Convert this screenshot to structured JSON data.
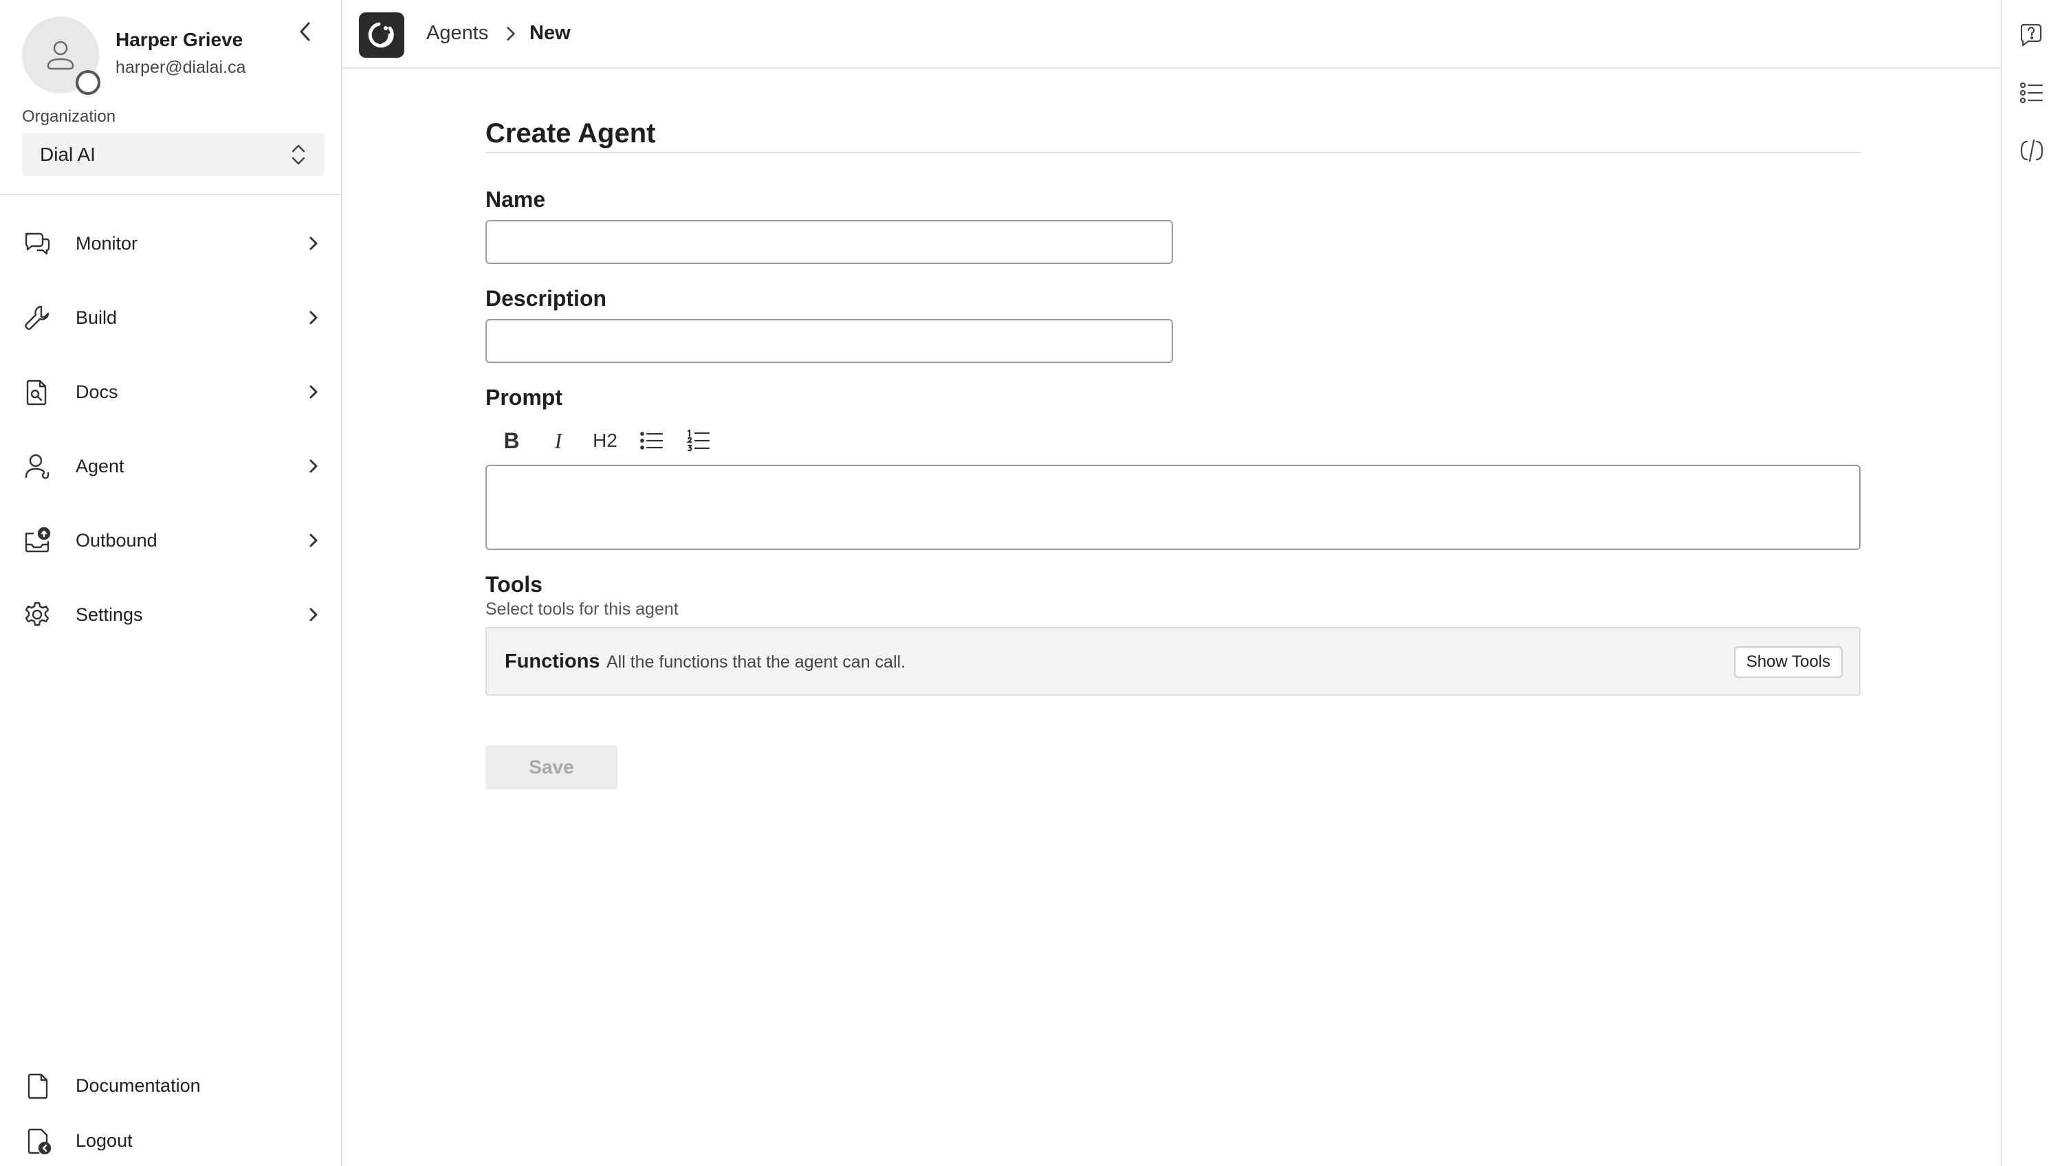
{
  "user": {
    "name": "Harper Grieve",
    "email": "harper@dialai.ca"
  },
  "organization": {
    "label": "Organization",
    "selected": "Dial AI"
  },
  "sidebar": {
    "items": [
      {
        "label": "Monitor",
        "icon": "chat-bubbles-icon"
      },
      {
        "label": "Build",
        "icon": "wrench-icon"
      },
      {
        "label": "Docs",
        "icon": "document-search-icon"
      },
      {
        "label": "Agent",
        "icon": "user-headset-icon"
      },
      {
        "label": "Outbound",
        "icon": "outbound-inbox-icon"
      },
      {
        "label": "Settings",
        "icon": "gear-icon"
      }
    ],
    "bottom": [
      {
        "label": "Documentation",
        "icon": "document-icon"
      },
      {
        "label": "Logout",
        "icon": "logout-icon"
      }
    ]
  },
  "breadcrumb": {
    "parent": "Agents",
    "current": "New"
  },
  "form": {
    "title": "Create Agent",
    "name_label": "Name",
    "name_value": "",
    "description_label": "Description",
    "description_value": "",
    "prompt_label": "Prompt",
    "prompt_toolbar": {
      "bold": "B",
      "italic": "I",
      "heading": "H2"
    },
    "tools_title": "Tools",
    "tools_subtitle": "Select tools for this agent",
    "functions_title": "Functions",
    "functions_description": "All the functions that the agent can call.",
    "show_tools_label": "Show Tools",
    "save_label": "Save"
  },
  "colors": {
    "logo_bg": "#2b2b2b",
    "disabled_button_bg": "#ececec",
    "disabled_button_text": "#a8a8a8"
  }
}
